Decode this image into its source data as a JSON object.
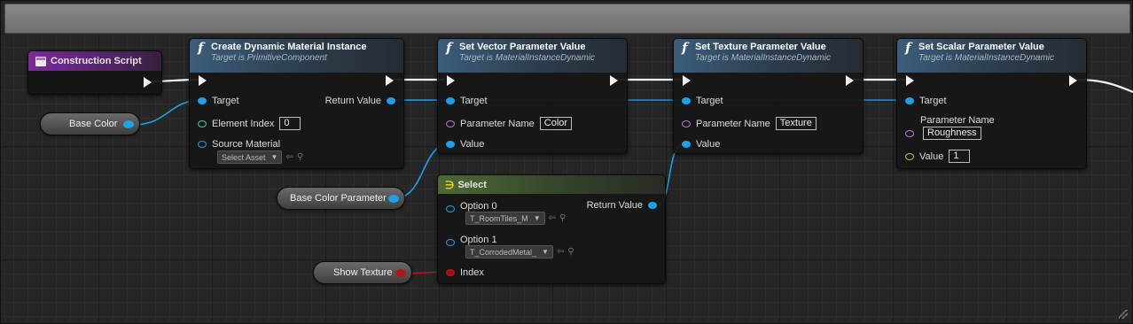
{
  "event_node": {
    "title": "Construction Script"
  },
  "variables": {
    "base_color": "Base Color",
    "base_color_parameter": "Base Color Parameter",
    "show_texture": "Show Texture"
  },
  "create_dmi": {
    "title": "Create Dynamic Material Instance",
    "subtitle": "Target is PrimitiveComponent",
    "target": "Target",
    "return_value": "Return Value",
    "element_index": "Element Index",
    "element_index_value": "0",
    "source_material": "Source Material",
    "source_material_value": "Select Asset"
  },
  "set_vector": {
    "title": "Set Vector Parameter Value",
    "subtitle": "Target is MaterialInstanceDynamic",
    "target": "Target",
    "parameter_name": "Parameter Name",
    "parameter_name_value": "Color",
    "value": "Value"
  },
  "set_texture": {
    "title": "Set Texture Parameter Value",
    "subtitle": "Target is MaterialInstanceDynamic",
    "target": "Target",
    "parameter_name": "Parameter Name",
    "parameter_name_value": "Texture",
    "value": "Value"
  },
  "set_scalar": {
    "title": "Set Scalar Parameter Value",
    "subtitle": "Target is MaterialInstanceDynamic",
    "target": "Target",
    "parameter_name": "Parameter Name",
    "parameter_name_value": "Roughness",
    "value": "Value",
    "value_value": "1"
  },
  "select_node": {
    "title": "Select",
    "option0": "Option 0",
    "option0_value": "T_RoomTiles_M",
    "option1": "Option 1",
    "option1_value": "T_CorrodedMetal_",
    "index": "Index",
    "return_value": "Return Value"
  },
  "colors": {
    "object_pin": "#1aa3e8",
    "name_pin": "#b07ad8",
    "int_pin": "#3fcf8a",
    "float_pin": "#9ad82a",
    "bool_pin": "#a01010",
    "exec_wire": "#f2f2f2"
  }
}
